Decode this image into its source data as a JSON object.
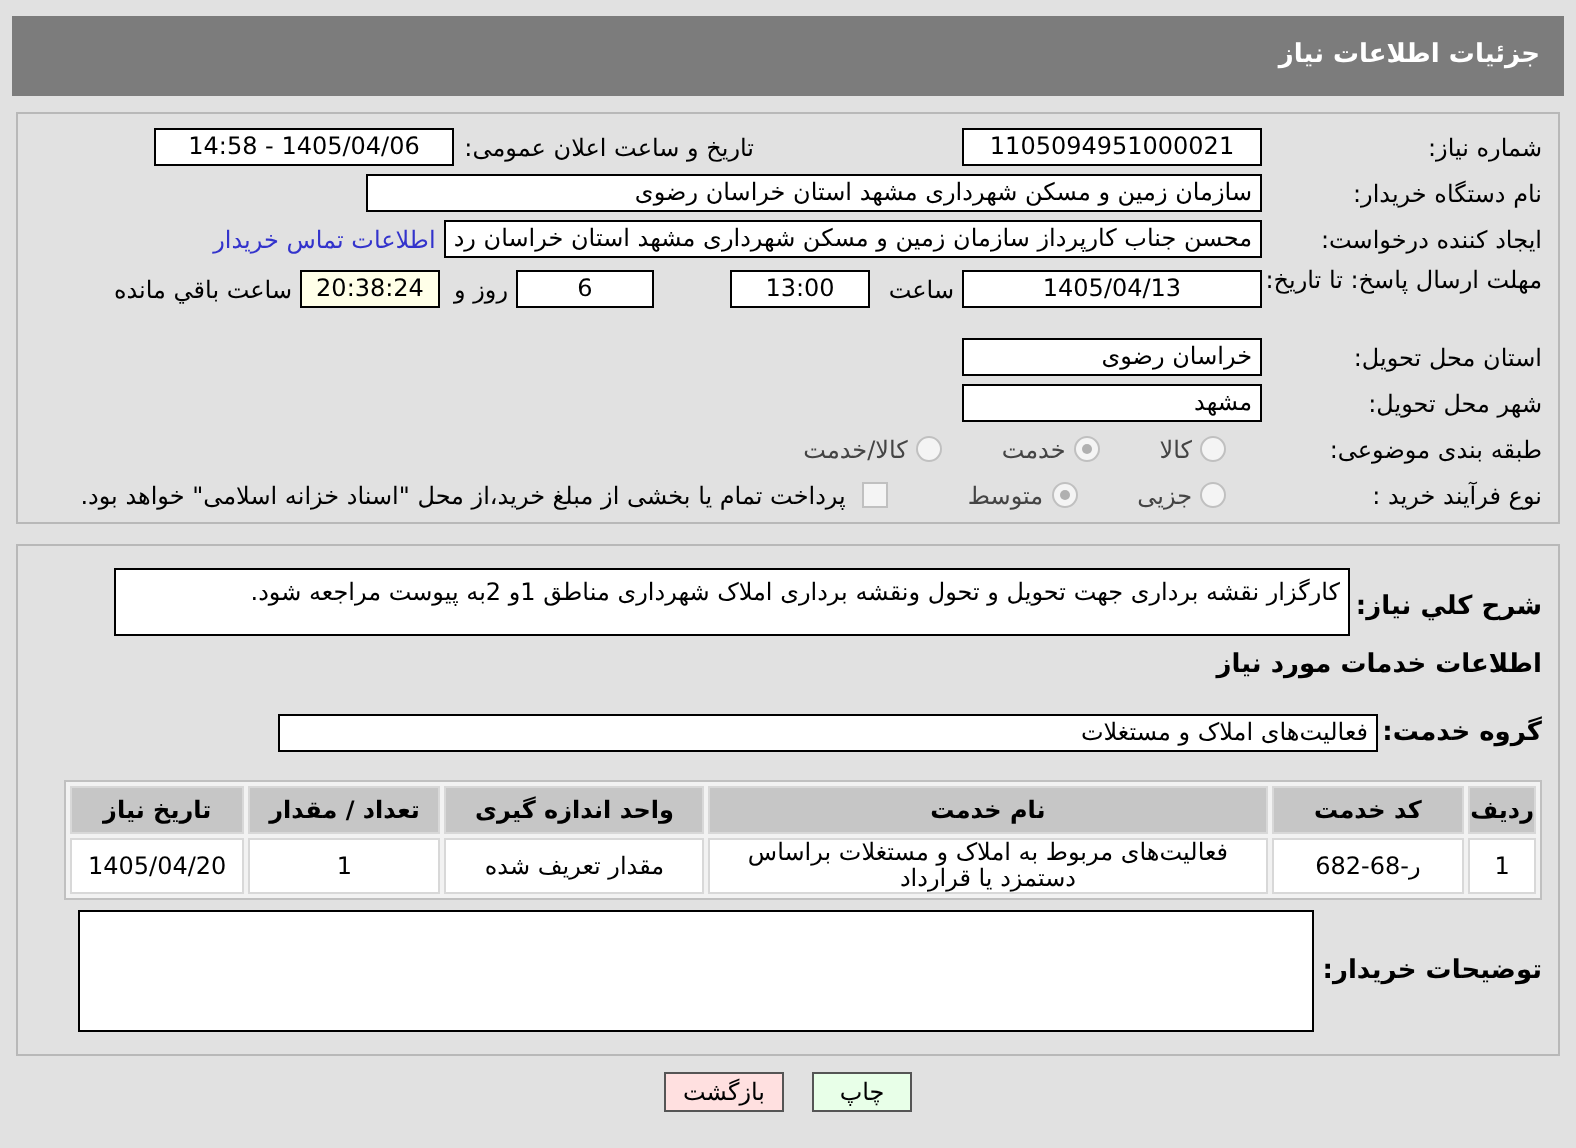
{
  "header": {
    "title": "جزئیات اطلاعات نیاز"
  },
  "need_number": {
    "label": "شماره نیاز:",
    "value": "1105094951000021"
  },
  "announce": {
    "label": "تاریخ و ساعت اعلان عمومی:",
    "value": "1405/04/06 - 14:58"
  },
  "buyer": {
    "label": "نام دستگاه خریدار:",
    "value": "سازمان زمین و مسکن شهرداری مشهد استان خراسان رضوی"
  },
  "creator": {
    "label": "ایجاد کننده درخواست:",
    "value": "محسن جناب کارپرداز سازمان زمین و مسکن شهرداری مشهد استان خراسان رد",
    "link": "اطلاعات تماس خریدار"
  },
  "deadline": {
    "label": "مهلت ارسال پاسخ: تا تاریخ:",
    "date": "1405/04/13",
    "time_label": "ساعت",
    "time": "13:00",
    "days": "6",
    "days_label": "روز و",
    "remaining": "20:38:24",
    "remaining_label": "ساعت باقي مانده"
  },
  "province": {
    "label": "استان محل تحویل:",
    "value": "خراسان رضوی"
  },
  "city": {
    "label": "شهر محل تحویل:",
    "value": "مشهد"
  },
  "category": {
    "label": "طبقه بندی موضوعی:",
    "options": [
      {
        "label": "کالا",
        "selected": false
      },
      {
        "label": "خدمت",
        "selected": true
      },
      {
        "label": "کالا/خدمت",
        "selected": false
      }
    ]
  },
  "process": {
    "label": "نوع فرآیند خرید :",
    "options": [
      {
        "label": "جزیی",
        "selected": false
      },
      {
        "label": "متوسط",
        "selected": true
      }
    ],
    "payment": {
      "checked": false,
      "text": "پرداخت تمام یا بخشی از مبلغ خرید،از محل \"اسناد خزانه اسلامی\" خواهد بود."
    }
  },
  "description": {
    "label": "شرح کلي نیاز:",
    "value": "کارگزار نقشه برداری جهت تحویل و تحول ونقشه برداری املاک شهرداری مناطق 1و 2به پیوست مراجعه شود."
  },
  "services_title": "اطلاعات خدمات مورد نیاز",
  "service_group": {
    "label": "گروه خدمت:",
    "value": "فعالیت‌های  املاک و مستغلات"
  },
  "table": {
    "columns": [
      "ردیف",
      "کد خدمت",
      "نام خدمت",
      "واحد اندازه گیری",
      "تعداد / مقدار",
      "تاریخ نیاز"
    ],
    "rows": [
      [
        "1",
        "ر-68-682",
        "فعالیت‌های مربوط به املاک و مستغلات براساس دستمزد یا قرارداد",
        "مقدار تعریف شده",
        "1",
        "1405/04/20"
      ]
    ]
  },
  "buyer_notes": {
    "label": "توضیحات خریدار:"
  },
  "buttons": [
    {
      "label": "چاپ",
      "kind": "print"
    },
    {
      "label": "بازگشت",
      "kind": "back"
    }
  ]
}
